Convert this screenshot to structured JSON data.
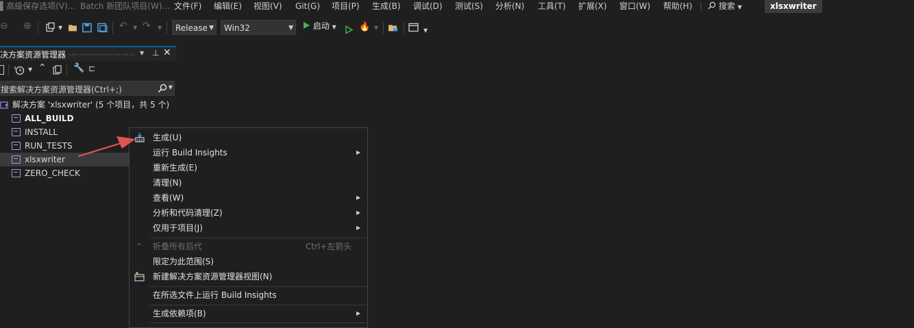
{
  "menubar": {
    "items": [
      "高级保存选项(V)...",
      "Batch 新团队项目(W)...",
      "文件(F)",
      "编辑(E)",
      "视图(V)",
      "Git(G)",
      "项目(P)",
      "生成(B)",
      "调试(D)",
      "测试(S)",
      "分析(N)",
      "工具(T)",
      "扩展(X)",
      "窗口(W)",
      "帮助(H)"
    ],
    "search_label": "搜索",
    "window_title": "xlsxwriter"
  },
  "toolbar": {
    "config_select": "Release",
    "platform_select": "Win32",
    "start_label": "启动"
  },
  "solution_explorer": {
    "title": "决方案资源管理器",
    "search_placeholder": "搜索解决方案资源管理器(Ctrl+;)",
    "solution_label": "解决方案 'xlsxwriter' (5 个项目，共 5 个)",
    "projects": [
      "ALL_BUILD",
      "INSTALL",
      "RUN_TESTS",
      "xlsxwriter",
      "ZERO_CHECK"
    ]
  },
  "context_menu": {
    "build": "生成(U)",
    "build_insights": "运行 Build Insights",
    "rebuild": "重新生成(E)",
    "clean": "清理(N)",
    "view": "查看(W)",
    "analyze": "分析和代码清理(Z)",
    "project_only": "仅用于项目(J)",
    "collapse_all": "折叠所有后代",
    "collapse_shortcut": "Ctrl+左箭头",
    "scope_to_this": "限定为此范围(S)",
    "new_view": "新建解决方案资源管理器视图(N)",
    "build_insights_selected": "在所选文件上运行 Build Insights",
    "build_dependencies": "生成依赖项(B)"
  },
  "colors": {
    "accent": "#0e639c",
    "arrow": "#e05353",
    "play": "#3fb950"
  }
}
